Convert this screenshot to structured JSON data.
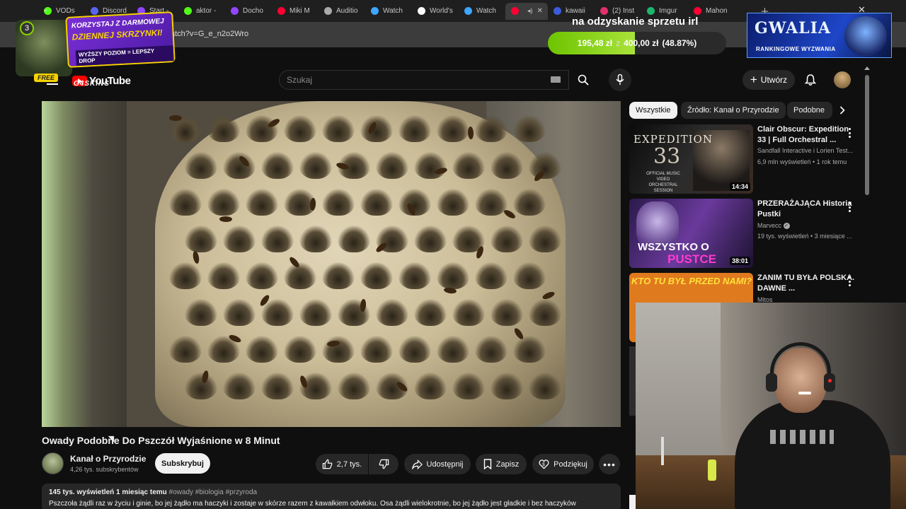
{
  "browser": {
    "tabs": [
      {
        "label": "VODs",
        "color": "#53fc18"
      },
      {
        "label": "Discord",
        "color": "#5865f2"
      },
      {
        "label": "Start -",
        "color": "#9146ff"
      },
      {
        "label": "aktor -",
        "color": "#53fc18"
      },
      {
        "label": "Docho",
        "color": "#9146ff"
      },
      {
        "label": "Miki M",
        "color": "#ff0033"
      },
      {
        "label": "Auditio",
        "color": "#aaaaaa"
      },
      {
        "label": "Watch",
        "color": "#3ea6ff"
      },
      {
        "label": "World's",
        "color": "#ffffff"
      },
      {
        "label": "Watch",
        "color": "#3ea6ff"
      },
      {
        "label": "",
        "color": "#ff0033"
      },
      {
        "label": "kawaii",
        "color": "#3b5bdb"
      },
      {
        "label": "(2) Inst",
        "color": "#e1306c"
      },
      {
        "label": "Imgur",
        "color": "#1bb76e"
      },
      {
        "label": "Mahon",
        "color": "#ff0033"
      }
    ],
    "url": "/watch?v=G_e_n2o2Wro"
  },
  "overlays": {
    "promo": {
      "badge": "3",
      "line1": "KORZYSTAJ Z DARMOWEJ",
      "line2": "DZIENNEJ SKRZYNKI!",
      "line3": "WYŻSZY POZIOM = LEPSZY DROP",
      "free": "FREE",
      "brand": "G4SKINS"
    },
    "goal": {
      "title": "na odzyskanie sprzetu irl",
      "current": "195,48 zł",
      "sep": "z",
      "target": "400,00 zł",
      "percent_label": "(48.87%)",
      "progress": 0.4887
    },
    "gwalia": {
      "title": "GWALIA",
      "subtitle": "RANKINGOWE WYZWANIA"
    }
  },
  "youtube": {
    "logo_text": "YouTube",
    "search_placeholder": "Szukaj",
    "create_label": "Utwórz",
    "video": {
      "title": "Owady Podobne Do Pszczół Wyjaśnione w 8 Minut",
      "channel": "Kanał o Przyrodzie",
      "subscribers": "4,26 tys. subskrybentów",
      "subscribe_label": "Subskrybuj",
      "likes": "2,7 tys.",
      "share_label": "Udostępnij",
      "save_label": "Zapisz",
      "thanks_label": "Podziękuj",
      "views_age": "145 tys. wyświetleń  1 miesiąc temu",
      "hashtags": "#owady #biologia #przyroda",
      "description": "Pszczoła żądli raz w życiu i ginie, bo jej żądło ma haczyki i zostaje w skórze razem z kawałkiem odwłoku. Osa żądli wielokrotnie, bo jej żądło jest gładkie i bez haczyków"
    },
    "chips": [
      "Wszystkie",
      "Źródło: Kanał o Przyrodzie",
      "Podobne"
    ],
    "recommendations": [
      {
        "title": "Clair Obscur: Expedition 33 | Full Orchestral ...",
        "channel": "Sandfall Interactive i Lorien Test...",
        "meta": "6,9 mln wyświetleń • 1 rok temu",
        "duration": "14:34",
        "thumb_title": "EXPEDITION",
        "thumb_number": "33",
        "thumb_caption": "OFFICIAL MUSIC VIDEO ORCHESTRAL SESSION"
      },
      {
        "title": "PRZERAŻAJĄCA Historia Pustki",
        "channel": "Marvecc",
        "meta": "19 tys. wyświetleń • 3 miesiące ...",
        "duration": "38:01",
        "thumb_line1": "WSZYSTKO O",
        "thumb_line2": "PUSTCE"
      },
      {
        "title": "ZANIM TU BYŁA POLSKA. DAWNE ...",
        "channel": "Mitos",
        "meta": "",
        "thumb_text": "KTO TU BYŁ PRZED NAMI?"
      }
    ]
  }
}
